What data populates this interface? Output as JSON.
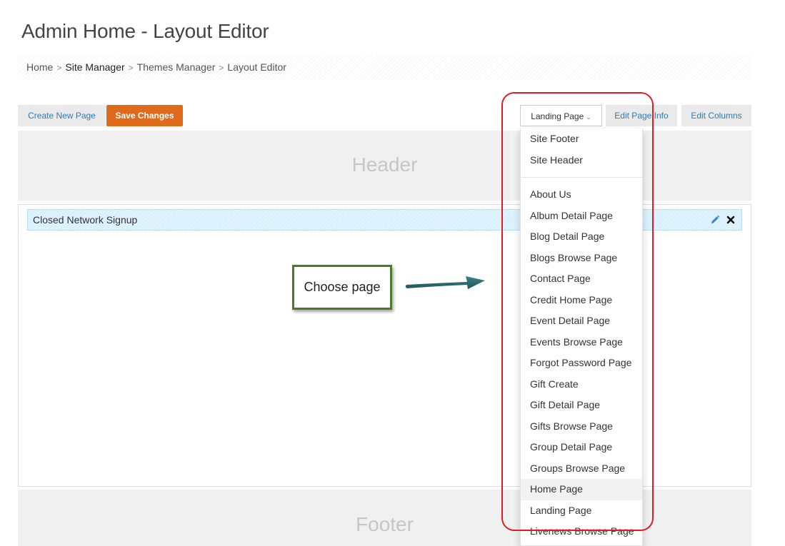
{
  "page": {
    "title": "Admin Home - Layout Editor"
  },
  "breadcrumb": {
    "items": [
      "Home",
      "Site Manager",
      "Themes Manager",
      "Layout Editor"
    ],
    "separator": ">"
  },
  "toolbar": {
    "create_label": "Create New Page",
    "save_label": "Save Changes",
    "page_select_value": "Landing Page",
    "edit_info_label": "Edit Page Info",
    "edit_columns_label": "Edit Columns"
  },
  "regions": {
    "header_label": "Header",
    "footer_label": "Footer"
  },
  "widget": {
    "title": "Closed Network Signup",
    "edit_icon": "pencil-icon",
    "remove_icon": "close-icon"
  },
  "callout": {
    "text": "Choose page"
  },
  "dropdown": {
    "group1": [
      "Site Footer",
      "Site Header"
    ],
    "group2": [
      "About Us",
      "Album Detail Page",
      "Blog Detail Page",
      "Blogs Browse Page",
      "Contact Page",
      "Credit Home Page",
      "Event Detail Page",
      "Events Browse Page",
      "Forgot Password Page",
      "Gift Create",
      "Gift Detail Page",
      "Gifts Browse Page",
      "Group Detail Page",
      "Groups Browse Page",
      "Home Page",
      "Landing Page",
      "Livenews Browse Page"
    ],
    "hover_item": "Home Page"
  },
  "colors": {
    "save_button": "#e06a1b",
    "link_blue": "#2e7ab8",
    "annotation_red": "#e11b22",
    "callout_border": "#4a7a2a",
    "arrow_teal": "#1e5f63"
  }
}
